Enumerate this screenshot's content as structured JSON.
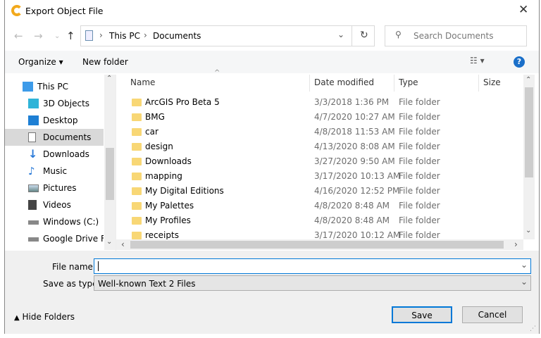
{
  "window": {
    "title": "Export Object File",
    "close": "✕"
  },
  "address": {
    "crumbs": [
      "This PC",
      "Documents"
    ],
    "search_placeholder": "Search Documents"
  },
  "toolbar": {
    "organize": "Organize ▾",
    "new_folder": "New folder",
    "help": "?"
  },
  "sidebar": {
    "items": [
      {
        "label": "This PC"
      },
      {
        "label": "3D Objects"
      },
      {
        "label": "Desktop"
      },
      {
        "label": "Documents",
        "selected": true
      },
      {
        "label": "Downloads"
      },
      {
        "label": "Music"
      },
      {
        "label": "Pictures"
      },
      {
        "label": "Videos"
      },
      {
        "label": "Windows (C:)"
      },
      {
        "label": "Google Drive File"
      }
    ]
  },
  "columns": [
    "Name",
    "Date modified",
    "Type",
    "Size"
  ],
  "files": [
    {
      "name": "ArcGIS Pro Beta 5",
      "date": "3/3/2018 1:36 PM",
      "type": "File folder"
    },
    {
      "name": "BMG",
      "date": "4/7/2020 10:27 AM",
      "type": "File folder"
    },
    {
      "name": "car",
      "date": "4/8/2018 11:53 AM",
      "type": "File folder"
    },
    {
      "name": "design",
      "date": "4/13/2020 8:08 AM",
      "type": "File folder"
    },
    {
      "name": "Downloads",
      "date": "3/27/2020 9:50 AM",
      "type": "File folder"
    },
    {
      "name": "mapping",
      "date": "3/17/2020 10:13 AM",
      "type": "File folder"
    },
    {
      "name": "My Digital Editions",
      "date": "4/16/2020 12:52 PM",
      "type": "File folder"
    },
    {
      "name": "My Palettes",
      "date": "4/8/2020 8:48 AM",
      "type": "File folder"
    },
    {
      "name": "My Profiles",
      "date": "4/8/2020 8:48 AM",
      "type": "File folder"
    },
    {
      "name": "receipts",
      "date": "3/17/2020 10:12 AM",
      "type": "File folder"
    }
  ],
  "form": {
    "file_name_label": "File name:",
    "file_name_value": "",
    "save_type_label": "Save as type:",
    "save_type_value": "Well-known Text 2 Files"
  },
  "footer": {
    "hide_folders": "Hide Folders",
    "save": "Save",
    "cancel": "Cancel"
  },
  "colors": {
    "accent": "#0078d7",
    "folder": "#f8d775"
  }
}
